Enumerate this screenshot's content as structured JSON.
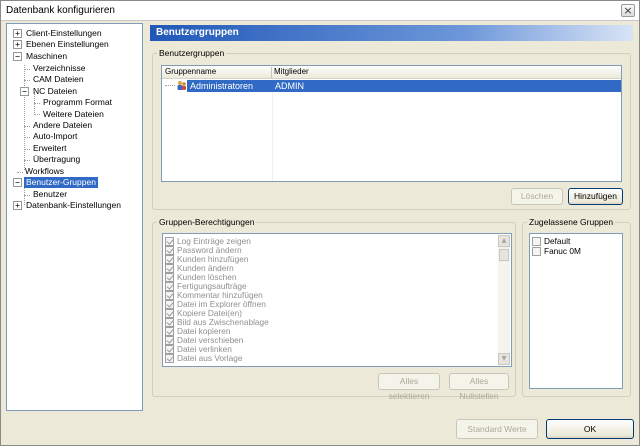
{
  "window": {
    "title": "Datenbank konfigurieren",
    "close_glyph": "×"
  },
  "tree": {
    "items": [
      {
        "label": "Client-Einstellungen",
        "expander": "+"
      },
      {
        "label": "Ebenen Einstellungen",
        "expander": "+"
      },
      {
        "label": "Maschinen",
        "expander": "−"
      },
      {
        "label": "Verzeichnisse"
      },
      {
        "label": "CAM Dateien"
      },
      {
        "label": "NC Dateien",
        "expander": "−"
      },
      {
        "label": "Programm Format"
      },
      {
        "label": "Weitere Dateien"
      },
      {
        "label": "Andere Dateien"
      },
      {
        "label": "Auto-Import"
      },
      {
        "label": "Erweitert"
      },
      {
        "label": "Übertragung"
      },
      {
        "label": "Workflows"
      },
      {
        "label": "Benutzer-Gruppen",
        "expander": "−",
        "selected": true
      },
      {
        "label": "Benutzer"
      },
      {
        "label": "Datenbank-Einstellungen",
        "expander": "+"
      }
    ]
  },
  "header": {
    "title": "Benutzergruppen"
  },
  "groups_box": {
    "legend": "Benutzergruppen",
    "columns": [
      "Gruppenname",
      "Mitglieder"
    ],
    "rows": [
      {
        "name": "Administratoren",
        "members": "ADMIN",
        "icon": "user-group-icon"
      }
    ],
    "delete_label": "Löschen",
    "add_label": "Hinzufügen"
  },
  "permissions_box": {
    "legend": "Gruppen-Berechtigungen",
    "items": [
      "Log Einträge zeigen",
      "Password ändern",
      "Kunden hinzufügen",
      "Kunden ändern",
      "Kunden löschen",
      "Fertigungsaufträge",
      "Kommentar hinzufügen",
      "Datei im Explorer öffnen",
      "Kopiere Datei(en)",
      "Bild aus Zwischenablage",
      "Datei kopieren",
      "Datei verschieben",
      "Datei verlinken",
      "Datei aus Vorlage"
    ],
    "select_all_label": "Alles selektieren",
    "reset_all_label": "Alles Nullstellen"
  },
  "allowed_box": {
    "legend": "Zugelassene Gruppen",
    "items": [
      "Default",
      "Fanuc 0M"
    ]
  },
  "footer": {
    "defaults_label": "Standard Werte",
    "ok_label": "OK"
  },
  "colors": {
    "selection": "#316ac5",
    "header_start": "#2058b8",
    "dialog_bg": "#ece9d8"
  }
}
